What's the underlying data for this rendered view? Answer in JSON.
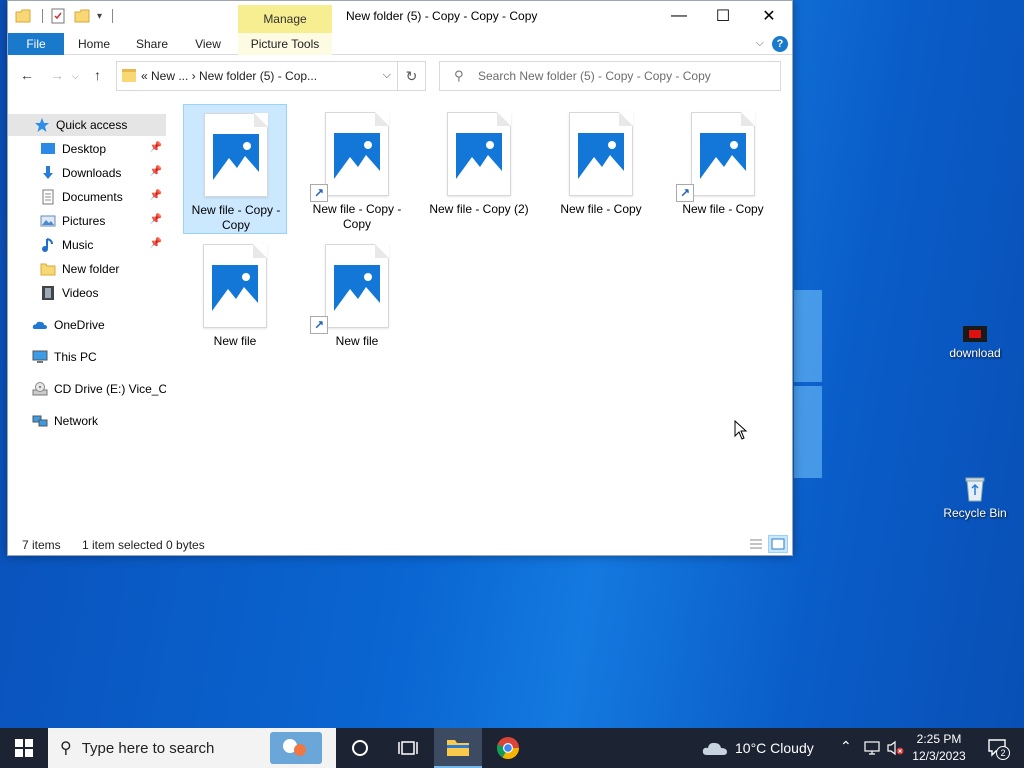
{
  "window": {
    "title": "New folder (5) - Copy - Copy - Copy",
    "contextual_tab_group": "Manage",
    "controls": {
      "minimize": "—",
      "maximize": "☐",
      "close": "✕"
    }
  },
  "ribbon": {
    "tabs": [
      {
        "label": "File"
      },
      {
        "label": "Home"
      },
      {
        "label": "Share"
      },
      {
        "label": "View"
      },
      {
        "label": "Picture Tools"
      }
    ],
    "help": "?"
  },
  "navigation": {
    "back": "←",
    "forward": "→",
    "up": "↑",
    "address_breadcrumb": "«  New ...  ›  New folder (5) - Cop...",
    "search_placeholder": "Search New folder (5) - Copy - Copy - Copy"
  },
  "nav_pane": {
    "items": [
      {
        "label": "Quick access",
        "icon": "star-icon"
      },
      {
        "label": "Desktop",
        "icon": "desktop-icon",
        "pinned": true
      },
      {
        "label": "Downloads",
        "icon": "download-arrow-icon",
        "pinned": true
      },
      {
        "label": "Documents",
        "icon": "document-icon",
        "pinned": true
      },
      {
        "label": "Pictures",
        "icon": "pictures-icon",
        "pinned": true
      },
      {
        "label": "Music",
        "icon": "music-note-icon",
        "pinned": true
      },
      {
        "label": "New folder",
        "icon": "folder-icon"
      },
      {
        "label": "Videos",
        "icon": "film-icon"
      },
      {
        "label": "OneDrive",
        "icon": "cloud-icon"
      },
      {
        "label": "This PC",
        "icon": "computer-icon"
      },
      {
        "label": "CD Drive (E:) Vice_Cit",
        "icon": "cd-drive-icon"
      },
      {
        "label": "Network",
        "icon": "network-icon"
      }
    ]
  },
  "files": [
    {
      "label": "New file - Copy - Copy",
      "shortcut": false,
      "selected": true
    },
    {
      "label": "New file - Copy - Copy",
      "shortcut": true,
      "selected": false
    },
    {
      "label": "New file - Copy (2)",
      "shortcut": false,
      "selected": false
    },
    {
      "label": "New file - Copy",
      "shortcut": false,
      "selected": false
    },
    {
      "label": "New file - Copy",
      "shortcut": true,
      "selected": false
    },
    {
      "label": "New file",
      "shortcut": false,
      "selected": false
    },
    {
      "label": "New file",
      "shortcut": true,
      "selected": false
    }
  ],
  "status": {
    "item_count": "7 items",
    "selection": "1 item selected  0 bytes"
  },
  "desktop_icons": [
    {
      "label": "download",
      "icon": "red-image-icon"
    },
    {
      "label": "Recycle Bin",
      "icon": "recycle-bin-icon"
    }
  ],
  "taskbar": {
    "search_placeholder": "Type here to search",
    "weather": "10°C  Cloudy",
    "time": "2:25 PM",
    "date": "12/3/2023",
    "notification_count": "2"
  },
  "colors": {
    "accent": "#1979ca",
    "selection_fill": "#cce8ff",
    "manage_tab": "#f7ee91",
    "taskbar": "#1c2433"
  }
}
